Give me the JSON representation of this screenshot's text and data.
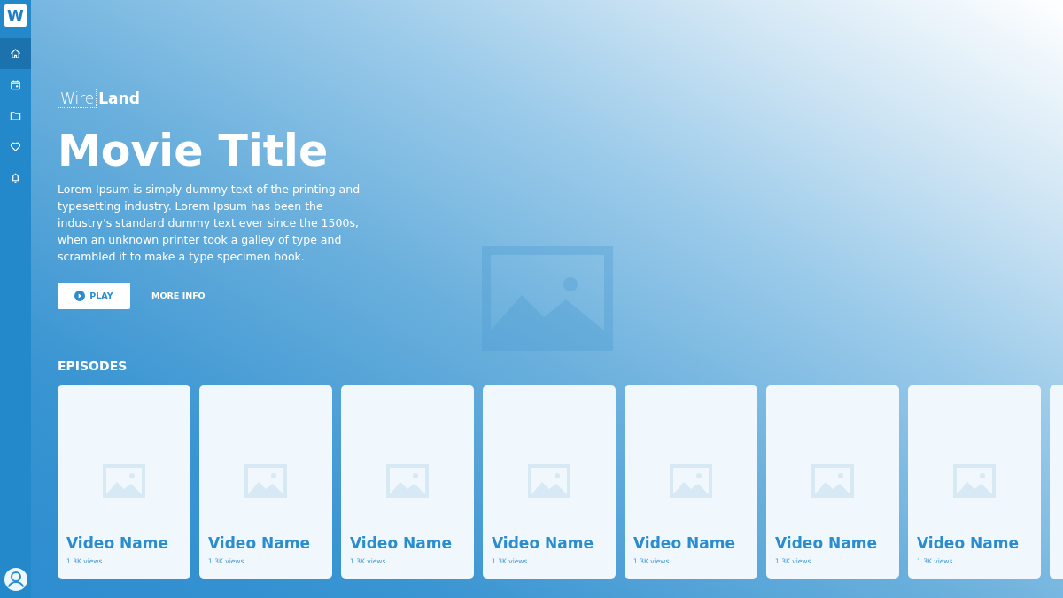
{
  "sidebar": {
    "logo": "W",
    "items": [
      {
        "selected": true
      },
      {
        "selected": false
      },
      {
        "selected": false
      },
      {
        "selected": false
      },
      {
        "selected": false
      }
    ]
  },
  "brand": {
    "light": "Wire",
    "bold": "Land"
  },
  "hero": {
    "title": "Movie Title",
    "description": "Lorem Ipsum is simply dummy text of the printing and typesetting industry. Lorem Ipsum has been the industry's standard dummy text ever since the 1500s, when an unknown printer took a galley of type and scrambled it to make a type specimen book.",
    "play": "PLAY",
    "more": "MORE INFO"
  },
  "episodes": {
    "heading": "EPISODES",
    "cards": [
      {
        "name": "Video Name",
        "views": "1.3K views"
      },
      {
        "name": "Video Name",
        "views": "1.3K views"
      },
      {
        "name": "Video Name",
        "views": "1.3K views"
      },
      {
        "name": "Video Name",
        "views": "1.3K views"
      },
      {
        "name": "Video Name",
        "views": "1.3K views"
      },
      {
        "name": "Video Name",
        "views": "1.3K views"
      },
      {
        "name": "Video Name",
        "views": "1.3K views"
      }
    ]
  }
}
